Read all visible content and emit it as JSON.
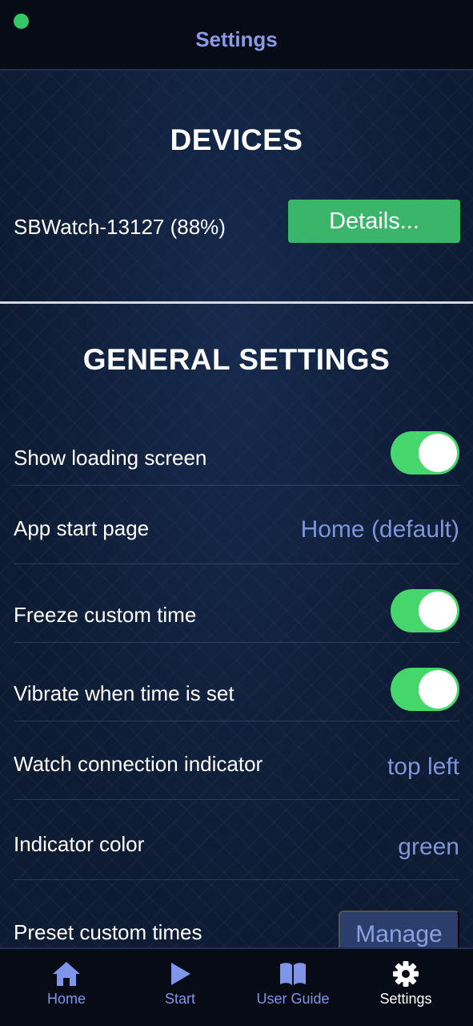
{
  "header": {
    "title": "Settings",
    "indicator_color": "#33c766"
  },
  "devices": {
    "title": "DEVICES",
    "device_name": "SBWatch-13127 (88%)",
    "details_label": "Details..."
  },
  "general": {
    "title": "GENERAL SETTINGS",
    "rows": [
      {
        "label": "Show loading screen",
        "toggle": true
      },
      {
        "label": "App start page",
        "value": "Home (default)"
      },
      {
        "label": "Freeze custom time",
        "toggle": true
      },
      {
        "label": "Vibrate when time is set",
        "toggle": true
      },
      {
        "label": "Watch connection indicator",
        "value": "top left"
      },
      {
        "label": "Indicator color",
        "value": "green"
      },
      {
        "label": "Preset custom times",
        "button": "Manage"
      }
    ]
  },
  "tabs": [
    {
      "label": "Home",
      "icon": "home-icon"
    },
    {
      "label": "Start",
      "icon": "play-icon"
    },
    {
      "label": "User Guide",
      "icon": "book-icon"
    },
    {
      "label": "Settings",
      "icon": "gear-icon",
      "active": true
    }
  ],
  "colors": {
    "accent": "#8a9ae8",
    "toggle_on": "#45d66c",
    "details_button": "#3bb56a"
  }
}
